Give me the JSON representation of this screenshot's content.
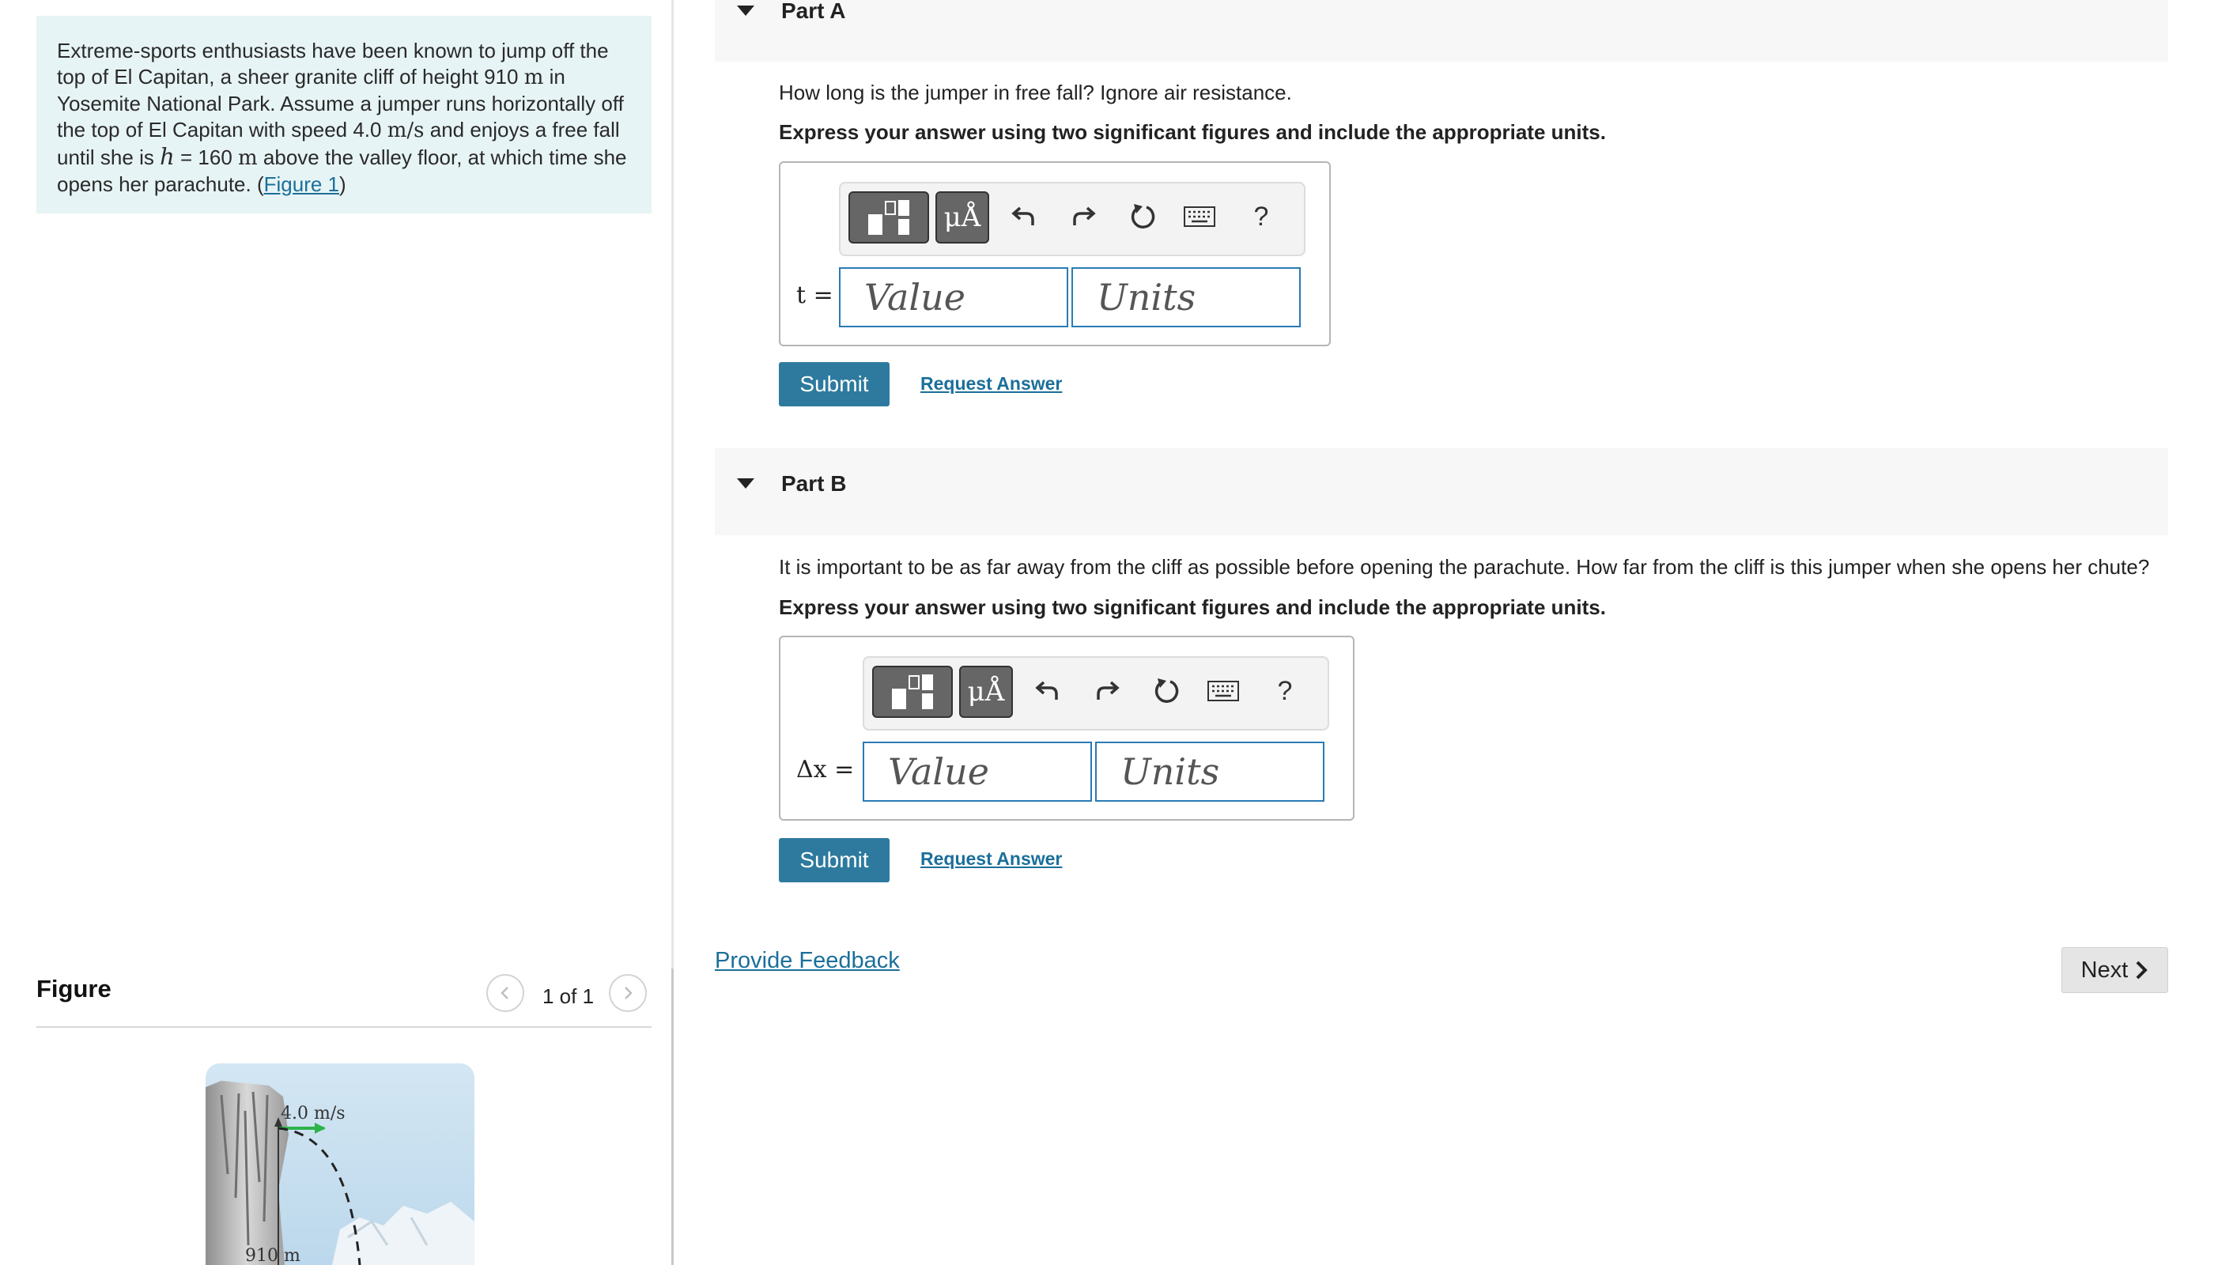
{
  "problem": {
    "text_1": "Extreme-sports enthusiasts have been known to jump off the top of El Capitan, a sheer granite cliff of height 910",
    "unit_m": "m",
    "text_2": "in Yosemite National Park. Assume a jumper runs horizontally off the top of El Capitan with speed 4.0",
    "unit_ms": "m/s",
    "text_3": "and enjoys a free fall until she is",
    "var_h": "h",
    "text_4": "= 160",
    "unit_m2": "m",
    "text_5": "above the valley floor, at which time she opens her parachute. (",
    "figure_link": "Figure 1",
    "text_6": ")"
  },
  "figure": {
    "title": "Figure",
    "pager": "1 of 1",
    "speed_label": "4.0 m/s",
    "height_label": "910 m"
  },
  "part_a": {
    "title": "Part A",
    "question": "How long is the jumper in free fall? Ignore air resistance.",
    "instruction": "Express your answer using two significant figures and include the appropriate units.",
    "var_label": "t =",
    "value_placeholder": "Value",
    "units_placeholder": "Units",
    "submit": "Submit",
    "request": "Request Answer"
  },
  "part_b": {
    "title": "Part B",
    "question": "It is important to be as far away from the cliff as possible before opening the parachute. How far from the cliff is this jumper when she opens her chute?",
    "instruction": "Express your answer using two significant figures and include the appropriate units.",
    "var_label": "Δx =",
    "value_placeholder": "Value",
    "units_placeholder": "Units",
    "submit": "Submit",
    "request": "Request Answer"
  },
  "toolbar": {
    "mu_label": "μÅ",
    "help_label": "?",
    "icons": [
      "templates-icon",
      "units-mu-icon",
      "undo-icon",
      "redo-icon",
      "reset-icon",
      "keyboard-icon",
      "help-icon"
    ]
  },
  "footer": {
    "feedback": "Provide Feedback",
    "next": "Next"
  },
  "colors": {
    "accent": "#2d7a9e",
    "link": "#1b6f9a",
    "problem_bg": "#e7f4f5",
    "input_border": "#2a7bb4"
  }
}
